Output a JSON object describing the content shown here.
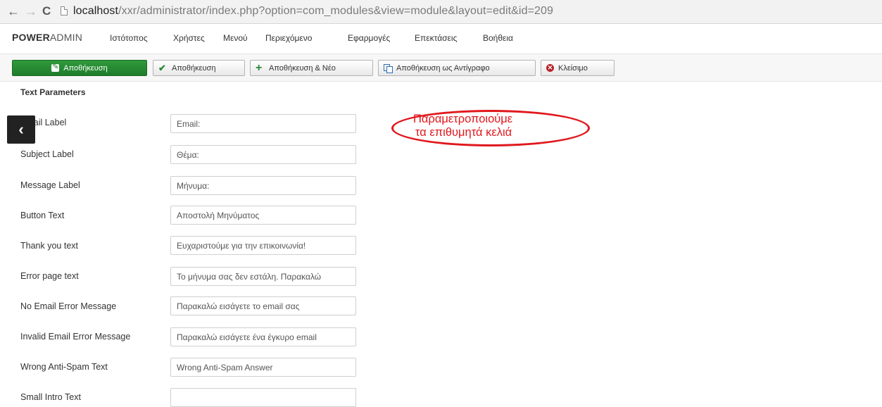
{
  "browser": {
    "url_host": "localhost",
    "url_rest": "/xxr/administrator/index.php?option=com_modules&view=module&layout=edit&id=209"
  },
  "admin": {
    "brand_bold": "POWER",
    "brand_light": "ADMIN",
    "menu": [
      "Ιστότοπος",
      "Χρήστες",
      "Μενού",
      "Περιεχόμενο",
      "Εφαρμογές",
      "Επεκτάσεις",
      "Βοήθεια"
    ]
  },
  "toolbar": {
    "save_edit": "Αποθήκευση",
    "save": "Αποθήκευση",
    "save_new": "Αποθήκευση & Νέο",
    "save_copy": "Αποθήκευση ως Αντίγραφο",
    "close": "Κλείσιμο"
  },
  "section": {
    "title": "Text Parameters"
  },
  "fields": [
    {
      "label": "Email Label",
      "value": "Email:"
    },
    {
      "label": "Subject Label",
      "value": "Θέμα:"
    },
    {
      "label": "Message Label",
      "value": "Μήνυμα:"
    },
    {
      "label": "Button Text",
      "value": "Αποστολή Μηνύματος"
    },
    {
      "label": "Thank you text",
      "value": "Ευχαριστούμε για την επικοινωνία!"
    },
    {
      "label": "Error page text",
      "value": "Το μήνυμα σας δεν εστάλη. Παρακαλώ"
    },
    {
      "label": "No Email Error Message",
      "value": "Παρακαλώ εισάγετε το email σας"
    },
    {
      "label": "Invalid Email Error Message",
      "value": "Παρακαλώ εισάγετε ένα έγκυρο email"
    },
    {
      "label": "Wrong Anti-Spam Text",
      "value": "Wrong Anti-Spam Answer"
    },
    {
      "label": "Small Intro Text",
      "value": ""
    }
  ],
  "annotation": {
    "line1": "Παραμετροποιούμε",
    "line2": "τα επιθυμητά κελιά",
    "color": "#e0181d"
  },
  "sidebar_toggle": {
    "icon": "chevron-left-icon"
  }
}
